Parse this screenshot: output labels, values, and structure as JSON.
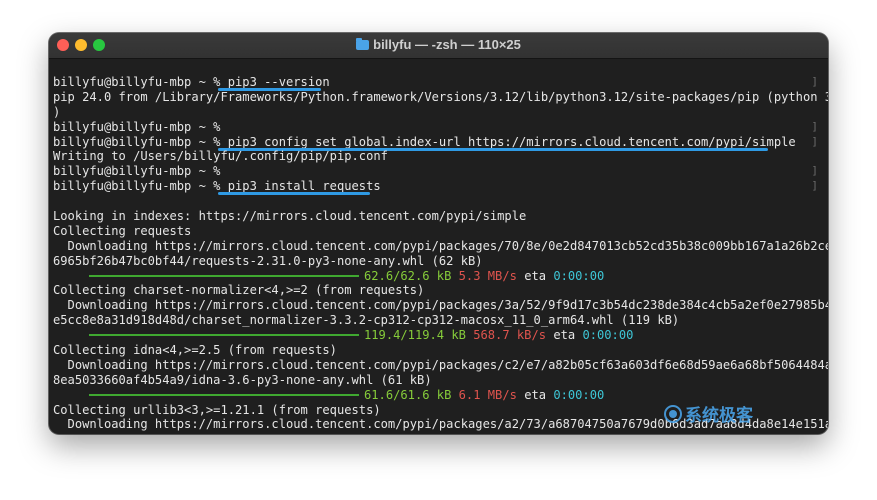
{
  "window": {
    "title": "billyfu — -zsh — 110×25",
    "icon": "folder-icon"
  },
  "terminal": {
    "prompt": "billyfu@billyfu-mbp ~ % ",
    "cmd1": "pip3 --version",
    "out_version_1": "pip 24.0 from /Library/Frameworks/Python.framework/Versions/3.12/lib/python3.12/site-packages/pip (python 3.12",
    "out_version_2": ")",
    "cmd_config": "pip3 config set global.index-url https://mirrors.cloud.tencent.com/pypi/simple",
    "out_writing": "Writing to /Users/billyfu/.config/pip/pip.conf",
    "cmd_install": "pip3 install requests",
    "looking": "Looking in indexes: https://mirrors.cloud.tencent.com/pypi/simple",
    "collect_requests": "Collecting requests",
    "dl1_a": "  Downloading https://mirrors.cloud.tencent.com/pypi/packages/70/8e/0e2d847013cb52cd35b38c009bb167a1a26b2ce6cd",
    "dl1_b": "6965bf26b47bc0bf44/requests-2.31.0-py3-none-any.whl (62 kB)",
    "p1_size": "62.6/62.6 kB",
    "p1_speed": "5.3 MB/s",
    "p1_eta": "0:00:00",
    "collect_charset": "Collecting charset-normalizer<4,>=2 (from requests)",
    "dl2_a": "  Downloading https://mirrors.cloud.tencent.com/pypi/packages/3a/52/9f9d17c3b54dc238de384c4cb5a2ef0e27985b42a0",
    "dl2_b": "e5cc8e8a31d918d48d/charset_normalizer-3.3.2-cp312-cp312-macosx_11_0_arm64.whl (119 kB)",
    "p2_size": "119.4/119.4 kB",
    "p2_speed": "568.7 kB/s",
    "p2_eta": "0:00:00",
    "collect_idna": "Collecting idna<4,>=2.5 (from requests)",
    "dl3_a": "  Downloading https://mirrors.cloud.tencent.com/pypi/packages/c2/e7/a82b05cf63a603df6e68d59ae6a68bf5064484a071",
    "dl3_b": "8ea5033660af4b54a9/idna-3.6-py3-none-any.whl (61 kB)",
    "p3_size": "61.6/61.6 kB",
    "p3_speed": "6.1 MB/s",
    "p3_eta": "0:00:00",
    "collect_urllib3": "Collecting urllib3<3,>=1.21.1 (from requests)",
    "dl4_a": "  Downloading https://mirrors.cloud.tencent.com/pypi/packages/a2/73/a68704750a7679d0b6d3ad7aa8d4da8e14e151ae82",
    "eta_label": "eta"
  },
  "watermark": {
    "text": "系统极客"
  },
  "colors": {
    "highlight": "#2f9ae4",
    "progress": "#3fa830",
    "size": "#86cc3a",
    "speed": "#e0544e",
    "eta": "#3ec6d6"
  }
}
